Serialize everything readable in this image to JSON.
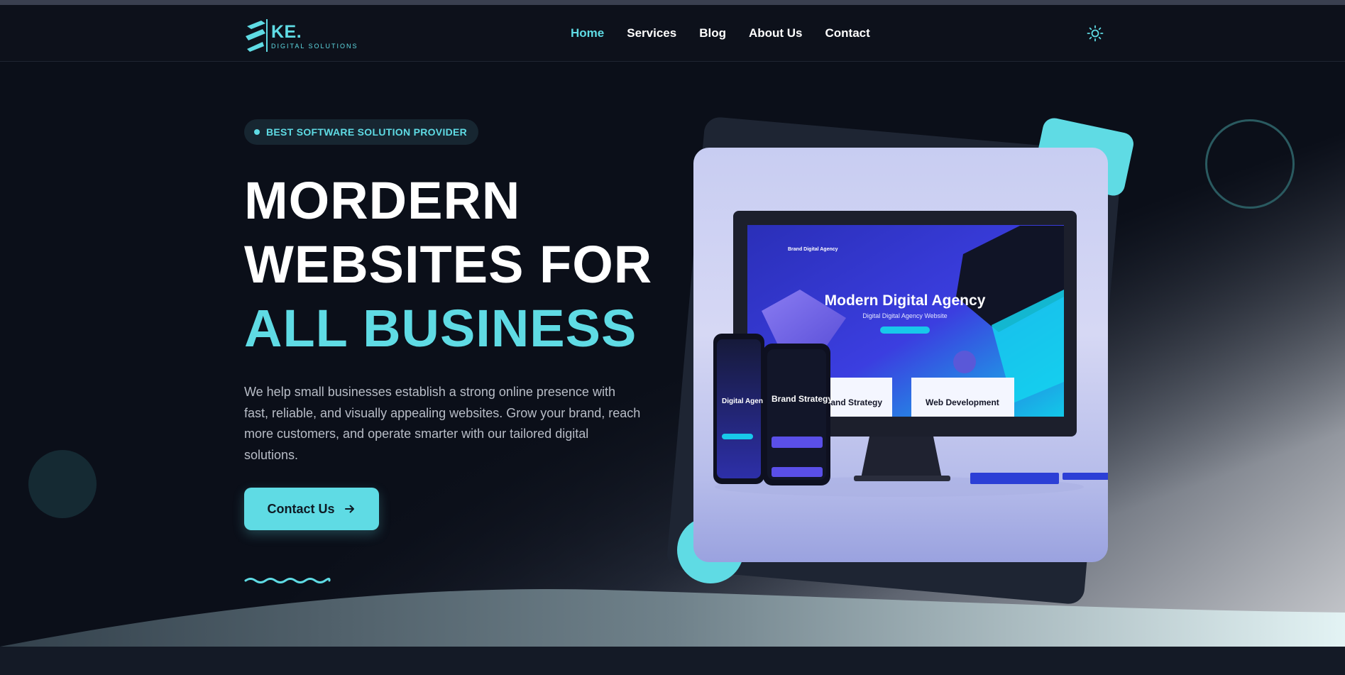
{
  "brand": {
    "name": "KE.",
    "tagline": "DIGITAL SOLUTIONS",
    "accent_color": "#5fdbe4",
    "background_color": "#0b0f19"
  },
  "nav": {
    "items": [
      {
        "label": "Home",
        "active": true
      },
      {
        "label": "Services",
        "active": false
      },
      {
        "label": "Blog",
        "active": false
      },
      {
        "label": "About Us",
        "active": false
      },
      {
        "label": "Contact",
        "active": false
      }
    ],
    "theme_toggle_icon": "sun-icon"
  },
  "hero": {
    "badge": "BEST SOFTWARE SOLUTION PROVIDER",
    "headline_line1": "MORDERN",
    "headline_line2": "WEBSITES FOR",
    "headline_line3": "ALL BUSINESS",
    "description": "We help small businesses establish a strong online presence with fast, reliable, and visually appealing websites. Grow your brand, reach more customers, and operate smarter with our tailored digital solutions.",
    "cta_label": "Contact Us",
    "cta_icon": "arrow-right-icon"
  },
  "mockup": {
    "screen_title": "Modern Digital Agency",
    "screen_subtitle": "Digital Digital Agency Website",
    "brand_label": "Brand Digital Agency",
    "card1": "Brand Strategy",
    "card2": "Web Development",
    "phone1_title": "Digital Agency",
    "phone2_title": "Brand Strategy"
  }
}
